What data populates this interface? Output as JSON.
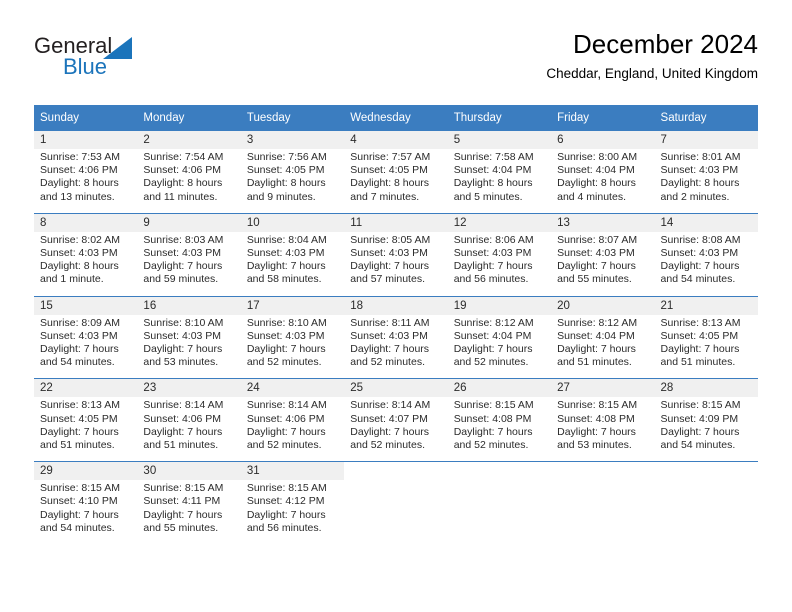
{
  "logo": {
    "word_one": "General",
    "word_two": "Blue",
    "triangle_color": "#1b74bb"
  },
  "header": {
    "title": "December 2024",
    "subtitle": "Cheddar, England, United Kingdom"
  },
  "colors": {
    "header_blue": "#3b7dc0",
    "daynum_band": "#f0f0f0",
    "text": "#2b2b2b"
  },
  "weekday_headers": [
    "Sunday",
    "Monday",
    "Tuesday",
    "Wednesday",
    "Thursday",
    "Friday",
    "Saturday"
  ],
  "weeks": [
    [
      {
        "day": "1",
        "sunrise": "Sunrise: 7:53 AM",
        "sunset": "Sunset: 4:06 PM",
        "daylight_line1": "Daylight: 8 hours",
        "daylight_line2": "and 13 minutes."
      },
      {
        "day": "2",
        "sunrise": "Sunrise: 7:54 AM",
        "sunset": "Sunset: 4:06 PM",
        "daylight_line1": "Daylight: 8 hours",
        "daylight_line2": "and 11 minutes."
      },
      {
        "day": "3",
        "sunrise": "Sunrise: 7:56 AM",
        "sunset": "Sunset: 4:05 PM",
        "daylight_line1": "Daylight: 8 hours",
        "daylight_line2": "and 9 minutes."
      },
      {
        "day": "4",
        "sunrise": "Sunrise: 7:57 AM",
        "sunset": "Sunset: 4:05 PM",
        "daylight_line1": "Daylight: 8 hours",
        "daylight_line2": "and 7 minutes."
      },
      {
        "day": "5",
        "sunrise": "Sunrise: 7:58 AM",
        "sunset": "Sunset: 4:04 PM",
        "daylight_line1": "Daylight: 8 hours",
        "daylight_line2": "and 5 minutes."
      },
      {
        "day": "6",
        "sunrise": "Sunrise: 8:00 AM",
        "sunset": "Sunset: 4:04 PM",
        "daylight_line1": "Daylight: 8 hours",
        "daylight_line2": "and 4 minutes."
      },
      {
        "day": "7",
        "sunrise": "Sunrise: 8:01 AM",
        "sunset": "Sunset: 4:03 PM",
        "daylight_line1": "Daylight: 8 hours",
        "daylight_line2": "and 2 minutes."
      }
    ],
    [
      {
        "day": "8",
        "sunrise": "Sunrise: 8:02 AM",
        "sunset": "Sunset: 4:03 PM",
        "daylight_line1": "Daylight: 8 hours",
        "daylight_line2": "and 1 minute."
      },
      {
        "day": "9",
        "sunrise": "Sunrise: 8:03 AM",
        "sunset": "Sunset: 4:03 PM",
        "daylight_line1": "Daylight: 7 hours",
        "daylight_line2": "and 59 minutes."
      },
      {
        "day": "10",
        "sunrise": "Sunrise: 8:04 AM",
        "sunset": "Sunset: 4:03 PM",
        "daylight_line1": "Daylight: 7 hours",
        "daylight_line2": "and 58 minutes."
      },
      {
        "day": "11",
        "sunrise": "Sunrise: 8:05 AM",
        "sunset": "Sunset: 4:03 PM",
        "daylight_line1": "Daylight: 7 hours",
        "daylight_line2": "and 57 minutes."
      },
      {
        "day": "12",
        "sunrise": "Sunrise: 8:06 AM",
        "sunset": "Sunset: 4:03 PM",
        "daylight_line1": "Daylight: 7 hours",
        "daylight_line2": "and 56 minutes."
      },
      {
        "day": "13",
        "sunrise": "Sunrise: 8:07 AM",
        "sunset": "Sunset: 4:03 PM",
        "daylight_line1": "Daylight: 7 hours",
        "daylight_line2": "and 55 minutes."
      },
      {
        "day": "14",
        "sunrise": "Sunrise: 8:08 AM",
        "sunset": "Sunset: 4:03 PM",
        "daylight_line1": "Daylight: 7 hours",
        "daylight_line2": "and 54 minutes."
      }
    ],
    [
      {
        "day": "15",
        "sunrise": "Sunrise: 8:09 AM",
        "sunset": "Sunset: 4:03 PM",
        "daylight_line1": "Daylight: 7 hours",
        "daylight_line2": "and 54 minutes."
      },
      {
        "day": "16",
        "sunrise": "Sunrise: 8:10 AM",
        "sunset": "Sunset: 4:03 PM",
        "daylight_line1": "Daylight: 7 hours",
        "daylight_line2": "and 53 minutes."
      },
      {
        "day": "17",
        "sunrise": "Sunrise: 8:10 AM",
        "sunset": "Sunset: 4:03 PM",
        "daylight_line1": "Daylight: 7 hours",
        "daylight_line2": "and 52 minutes."
      },
      {
        "day": "18",
        "sunrise": "Sunrise: 8:11 AM",
        "sunset": "Sunset: 4:03 PM",
        "daylight_line1": "Daylight: 7 hours",
        "daylight_line2": "and 52 minutes."
      },
      {
        "day": "19",
        "sunrise": "Sunrise: 8:12 AM",
        "sunset": "Sunset: 4:04 PM",
        "daylight_line1": "Daylight: 7 hours",
        "daylight_line2": "and 52 minutes."
      },
      {
        "day": "20",
        "sunrise": "Sunrise: 8:12 AM",
        "sunset": "Sunset: 4:04 PM",
        "daylight_line1": "Daylight: 7 hours",
        "daylight_line2": "and 51 minutes."
      },
      {
        "day": "21",
        "sunrise": "Sunrise: 8:13 AM",
        "sunset": "Sunset: 4:05 PM",
        "daylight_line1": "Daylight: 7 hours",
        "daylight_line2": "and 51 minutes."
      }
    ],
    [
      {
        "day": "22",
        "sunrise": "Sunrise: 8:13 AM",
        "sunset": "Sunset: 4:05 PM",
        "daylight_line1": "Daylight: 7 hours",
        "daylight_line2": "and 51 minutes."
      },
      {
        "day": "23",
        "sunrise": "Sunrise: 8:14 AM",
        "sunset": "Sunset: 4:06 PM",
        "daylight_line1": "Daylight: 7 hours",
        "daylight_line2": "and 51 minutes."
      },
      {
        "day": "24",
        "sunrise": "Sunrise: 8:14 AM",
        "sunset": "Sunset: 4:06 PM",
        "daylight_line1": "Daylight: 7 hours",
        "daylight_line2": "and 52 minutes."
      },
      {
        "day": "25",
        "sunrise": "Sunrise: 8:14 AM",
        "sunset": "Sunset: 4:07 PM",
        "daylight_line1": "Daylight: 7 hours",
        "daylight_line2": "and 52 minutes."
      },
      {
        "day": "26",
        "sunrise": "Sunrise: 8:15 AM",
        "sunset": "Sunset: 4:08 PM",
        "daylight_line1": "Daylight: 7 hours",
        "daylight_line2": "and 52 minutes."
      },
      {
        "day": "27",
        "sunrise": "Sunrise: 8:15 AM",
        "sunset": "Sunset: 4:08 PM",
        "daylight_line1": "Daylight: 7 hours",
        "daylight_line2": "and 53 minutes."
      },
      {
        "day": "28",
        "sunrise": "Sunrise: 8:15 AM",
        "sunset": "Sunset: 4:09 PM",
        "daylight_line1": "Daylight: 7 hours",
        "daylight_line2": "and 54 minutes."
      }
    ],
    [
      {
        "day": "29",
        "sunrise": "Sunrise: 8:15 AM",
        "sunset": "Sunset: 4:10 PM",
        "daylight_line1": "Daylight: 7 hours",
        "daylight_line2": "and 54 minutes."
      },
      {
        "day": "30",
        "sunrise": "Sunrise: 8:15 AM",
        "sunset": "Sunset: 4:11 PM",
        "daylight_line1": "Daylight: 7 hours",
        "daylight_line2": "and 55 minutes."
      },
      {
        "day": "31",
        "sunrise": "Sunrise: 8:15 AM",
        "sunset": "Sunset: 4:12 PM",
        "daylight_line1": "Daylight: 7 hours",
        "daylight_line2": "and 56 minutes."
      },
      {
        "day": "",
        "sunrise": "",
        "sunset": "",
        "daylight_line1": "",
        "daylight_line2": ""
      },
      {
        "day": "",
        "sunrise": "",
        "sunset": "",
        "daylight_line1": "",
        "daylight_line2": ""
      },
      {
        "day": "",
        "sunrise": "",
        "sunset": "",
        "daylight_line1": "",
        "daylight_line2": ""
      },
      {
        "day": "",
        "sunrise": "",
        "sunset": "",
        "daylight_line1": "",
        "daylight_line2": ""
      }
    ]
  ]
}
